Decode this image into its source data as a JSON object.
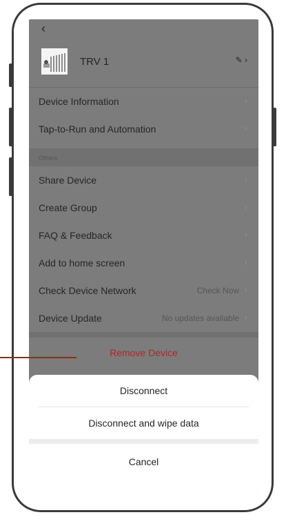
{
  "header": {
    "back_icon": "chevron-left-icon"
  },
  "device": {
    "name": "TRV 1",
    "edit_icon": "pencil-icon"
  },
  "rows_top": [
    {
      "label": "Device Information"
    },
    {
      "label": "Tap-to-Run and Automation"
    }
  ],
  "section": {
    "title": "Others"
  },
  "rows_others": [
    {
      "label": "Share Device",
      "value": ""
    },
    {
      "label": "Create Group",
      "value": ""
    },
    {
      "label": "FAQ & Feedback",
      "value": ""
    },
    {
      "label": "Add to home screen",
      "value": ""
    },
    {
      "label": "Check Device Network",
      "value": "Check Now"
    },
    {
      "label": "Device Update",
      "value": "No updates available"
    }
  ],
  "remove": {
    "label": "Remove Device"
  },
  "sheet": {
    "disconnect": "Disconnect",
    "disconnect_wipe": "Disconnect and wipe data",
    "cancel": "Cancel"
  },
  "colors": {
    "overlay": "#7c7c7c",
    "remove": "#b3252a",
    "callout": "#c0141b"
  }
}
